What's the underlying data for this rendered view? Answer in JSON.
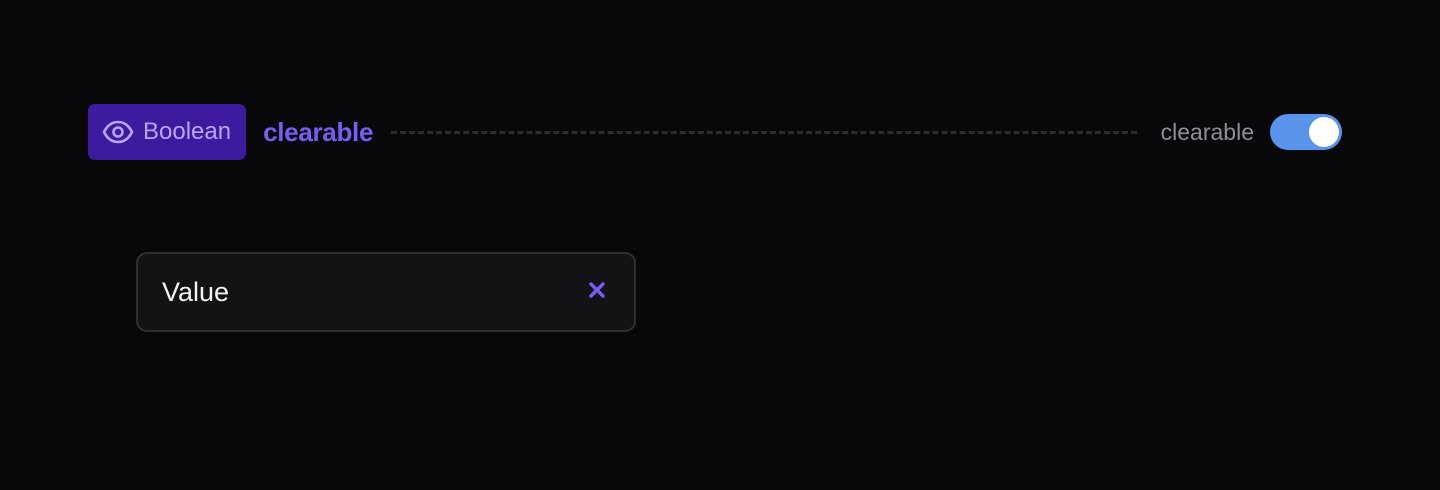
{
  "prop": {
    "type_icon": "eye-icon",
    "type_label": "Boolean",
    "name": "clearable"
  },
  "toggle": {
    "label": "clearable",
    "checked": true,
    "color": "#5a93ea"
  },
  "field": {
    "value": "Value",
    "clear_icon": "close-icon"
  },
  "colors": {
    "background": "#08080b",
    "badge_bg": "#3e1a9e",
    "badge_text": "#b7a6ff",
    "accent": "#7a5cf5"
  }
}
